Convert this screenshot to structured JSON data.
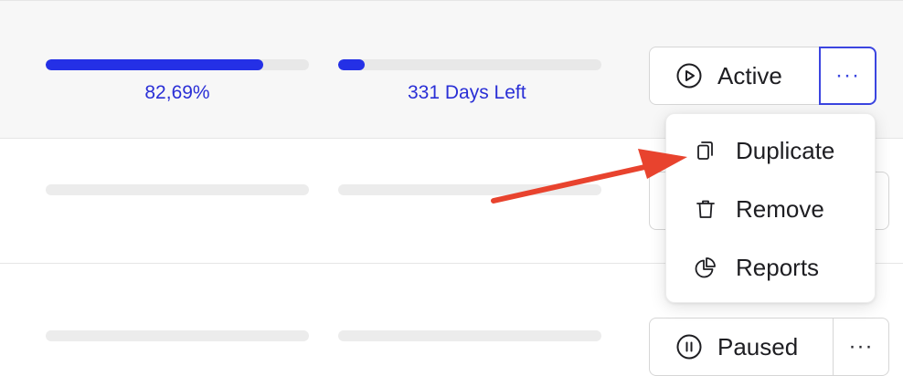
{
  "rows": [
    {
      "progress": {
        "label": "82,69%",
        "value": 0.8269
      },
      "time": {
        "label": "331 Days Left",
        "value": 0.1
      },
      "status_label": "Active",
      "more_label": "···"
    },
    {
      "status_label": "",
      "more_label": ""
    },
    {
      "status_label": "Paused",
      "more_label": "···"
    }
  ],
  "menu": {
    "items": [
      {
        "label": "Duplicate",
        "icon": "copy-icon"
      },
      {
        "label": "Remove",
        "icon": "trash-icon"
      },
      {
        "label": "Reports",
        "icon": "pie-chart-icon"
      }
    ]
  },
  "colors": {
    "accent": "#2430e6",
    "arrow": "#e8432e",
    "row_highlight": "#f7f7f7",
    "track": "#e8e8e8"
  }
}
